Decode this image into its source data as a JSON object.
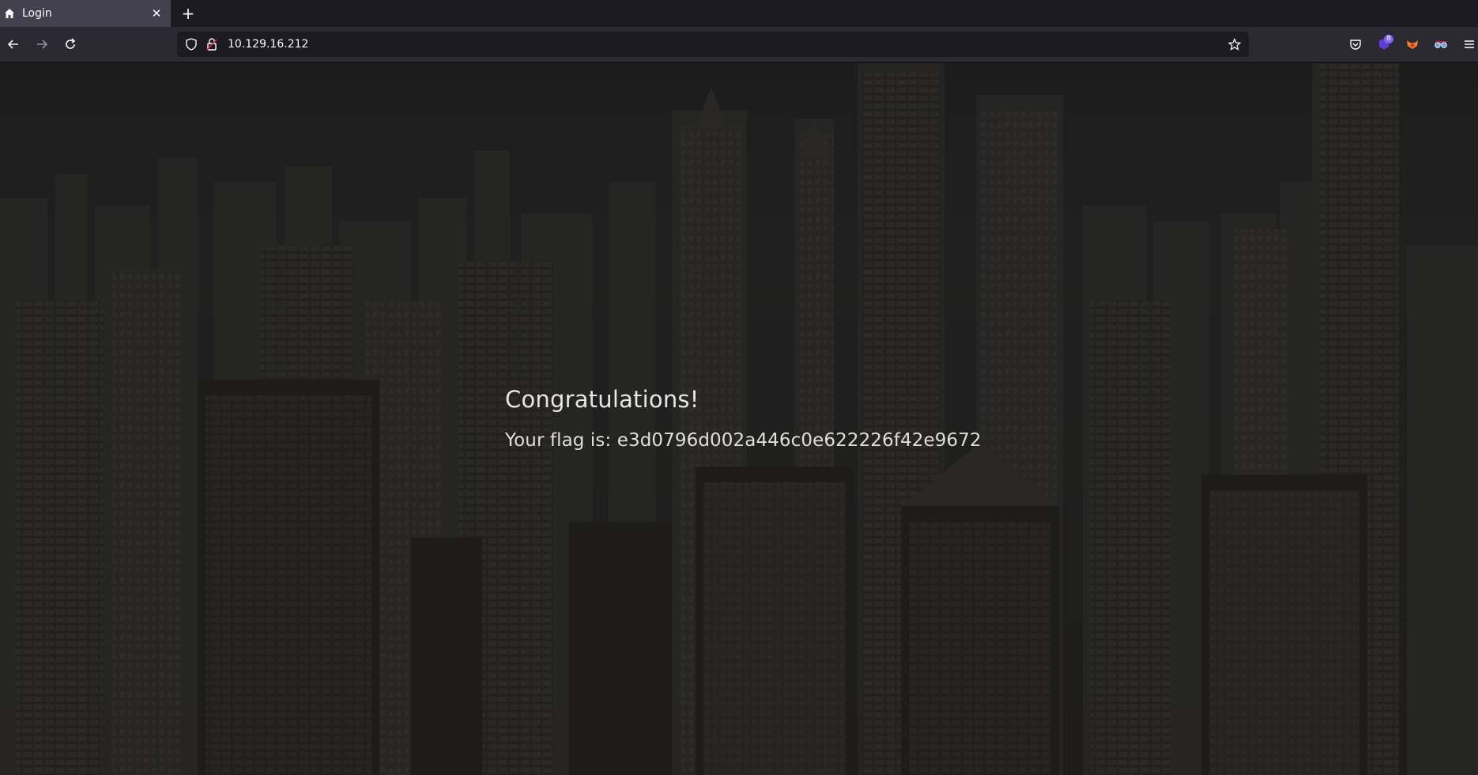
{
  "browser": {
    "tab": {
      "title": "Login",
      "favicon": "home-icon"
    },
    "url": "10.129.16.212",
    "extensions": [
      {
        "name": "pocket-icon"
      },
      {
        "name": "extension-purple-icon",
        "badge": "8"
      },
      {
        "name": "extension-fox-icon"
      },
      {
        "name": "extension-glasses-icon"
      }
    ]
  },
  "page": {
    "heading": "Congratulations!",
    "flag_text": "Your flag is: e3d0796d002a446c0e622226f42e9672"
  },
  "colors": {
    "toolbar": "#2b2a33",
    "tabstrip": "#1c1b22",
    "active_tab": "#42414d",
    "text": "#e8e6e3",
    "badge": "#7b61ff"
  }
}
